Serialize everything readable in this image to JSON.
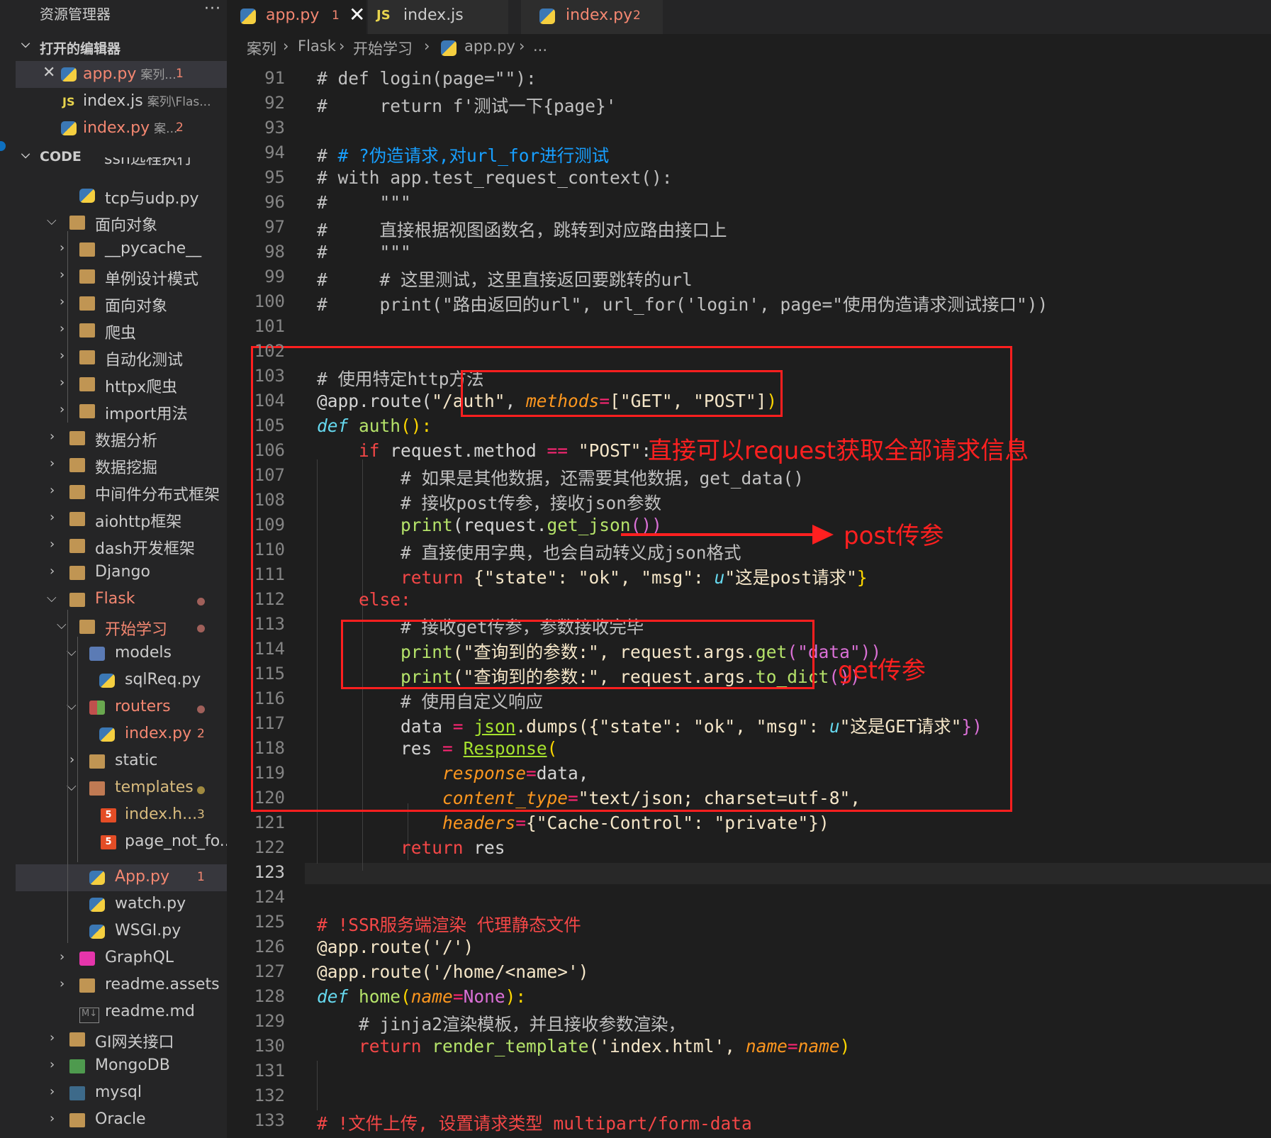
{
  "sidebar": {
    "title": "资源管理器",
    "more": "···",
    "open_editors_title": "打开的编辑器",
    "open_editors": [
      {
        "name": "app.py",
        "path": "案列...",
        "badge": "1"
      },
      {
        "name": "index.js",
        "path": "案列\\Flas...",
        "badge": ""
      },
      {
        "name": "index.py",
        "path": "案...",
        "badge": "2"
      }
    ],
    "workspace_title": "CODE",
    "tree": {
      "partial": "ssh远程执行",
      "tcp": "tcp与udp.py",
      "oop": "面向对象",
      "pycache": "__pycache__",
      "singleton": "单例设计模式",
      "oop2": "面向对象",
      "crawler": "爬虫",
      "autotest": "自动化测试",
      "httpx": "httpx爬虫",
      "import": "import用法",
      "analysis": "数据分析",
      "mining": "数据挖掘",
      "middleware": "中间件分布式框架",
      "aiohttp": "aiohttp框架",
      "dash": "dash开发框架",
      "django": "Django",
      "flask": "Flask",
      "start": "开始学习",
      "models": "models",
      "sqlreq": "sqlReq.py",
      "routers": "routers",
      "indexpy": "index.py",
      "indexpy_badge": "2",
      "static": "static",
      "templates": "templates",
      "indexhtml": "index.h...",
      "indexhtml_badge": "3",
      "pagenotfound": "page_not_fo...",
      "apppy": "App.py",
      "apppy_badge": "1",
      "watch": "watch.py",
      "wsgi": "WSGI.py",
      "graphql": "GraphQL",
      "readmeassets": "readme.assets",
      "readmemd": "readme.md",
      "gateway": "GI网关接口",
      "mongodb": "MongoDB",
      "mysql": "mysql",
      "oracle": "Oracle"
    }
  },
  "tabs": [
    {
      "label": "app.py",
      "badge": "1",
      "close": "✕"
    },
    {
      "label": "index.js",
      "icon": "JS"
    },
    {
      "label": "index.py",
      "badge": "2"
    }
  ],
  "breadcrumb": [
    "案列",
    "Flask",
    "开始学习",
    "app.py",
    "..."
  ],
  "line_numbers": [
    "91",
    "92",
    "93",
    "94",
    "95",
    "96",
    "97",
    "98",
    "99",
    "100",
    "101",
    "102",
    "103",
    "104",
    "105",
    "106",
    "107",
    "108",
    "109",
    "110",
    "111",
    "112",
    "113",
    "114",
    "115",
    "116",
    "117",
    "118",
    "119",
    "120",
    "121",
    "122",
    "123",
    "124",
    "125",
    "126",
    "127",
    "128",
    "129",
    "130",
    "131",
    "132",
    "133"
  ],
  "code": {
    "l91": "# def login(page=\"\"):",
    "l92": "#     return f'测试一下{page}'",
    "l94a": "# ",
    "l94b": "# ?伪造请求,对url_for进行测试",
    "l95": "# with app.test_request_context():",
    "l96": "#     \"\"\"",
    "l97": "#     直接根据视图函数名，跳转到对应路由接口上",
    "l98": "#     \"\"\"",
    "l99": "#     # 这里测试，这里直接返回要跳转的url",
    "l100": "#     print(\"路由返回的url\", url_for('login', page=\"使用伪造请求测试接口\"))",
    "l103": "# 使用特定http方法",
    "l104_deco": "@app.route(",
    "l104_str": "\"/auth\"",
    "l104_comma": ", ",
    "l104_param": "methods",
    "l104_eq": "=",
    "l104_list": "[\"GET\", \"POST\"]",
    "l104_close": ")",
    "l105_def": "def",
    "l105_name": " auth",
    "l105_rest": "():",
    "l106_if": "if",
    "l106_a": " request.method ",
    "l106_op": "==",
    "l106_str": " \"POST\"",
    "l106_colon": ":",
    "l107": "# 如果是其他数据，还需要其他数据，get_data()",
    "l108": "# 接收post传参，接收json参数",
    "l109_print": "print",
    "l109_rest": "(request.",
    "l109_fn": "get_json",
    "l109_close": "())",
    "l110": "# 直接使用字典，也会自动转义成json格式",
    "l111_ret": "return",
    "l111_rest": " {\"state\": \"ok\", \"msg\": ",
    "l111_u": "u",
    "l111_str": "\"这是post请求\"",
    "l111_close": "}",
    "l112": "else:",
    "l113": "# 接收get传参，参数接收完毕",
    "l114_print": "print",
    "l114_a": "(\"查询到的参数:\", request.args.",
    "l114_fn": "get",
    "l114_b": "(\"data\"))",
    "l115_print": "print",
    "l115_a": "(\"查询到的参数:\", request.args.",
    "l115_fn": "to_dict",
    "l115_b": "())",
    "l116": "# 使用自定义响应",
    "l117_a": "data ",
    "l117_eq": "=",
    "l117_sp": " ",
    "l117_json": "json",
    "l117_b": ".dumps({\"state\": \"ok\", \"msg\": ",
    "l117_u": "u",
    "l117_str": "\"这是GET请求\"",
    "l117_c": "})",
    "l118_a": "res ",
    "l118_eq": "=",
    "l118_sp": " ",
    "l118_cls": "Response",
    "l118_b": "(",
    "l119_p": "response",
    "l119_eq": "=",
    "l119_v": "data,",
    "l120_p": "content_type",
    "l120_eq": "=",
    "l120_v": "\"text/json; charset=utf-8\",",
    "l121_p": "headers",
    "l121_eq": "=",
    "l121_v": "{\"Cache-Control\": \"private\"})",
    "l122_ret": "return",
    "l122_v": " res",
    "l125": "# !SSR服务端渲染 代理静态文件",
    "l126": "@app.route('/')",
    "l127": "@app.route('/home/<name>')",
    "l128_def": "def",
    "l128_name": " home",
    "l128_a": "(",
    "l128_p": "name",
    "l128_eq": "=",
    "l128_none": "None",
    "l128_b": "):",
    "l129": "# jinja2渲染模板，并且接收参数渲染，",
    "l130_ret": "return",
    "l130_fn": " render_template",
    "l130_a": "('index.html', ",
    "l130_p": "name",
    "l130_eq": "=",
    "l130_v": "name",
    "l130_b": ")",
    "l133": "# !文件上传, 设置请求类型 multipart/form-data"
  },
  "annotations": {
    "request_all": "直接可以request获取全部请求信息",
    "post_param": "post传参",
    "get_param": "get传参"
  },
  "colors": {
    "annotation_red": "#ff2020",
    "editor_bg": "#1e1e1e",
    "sidebar_bg": "#252526"
  }
}
